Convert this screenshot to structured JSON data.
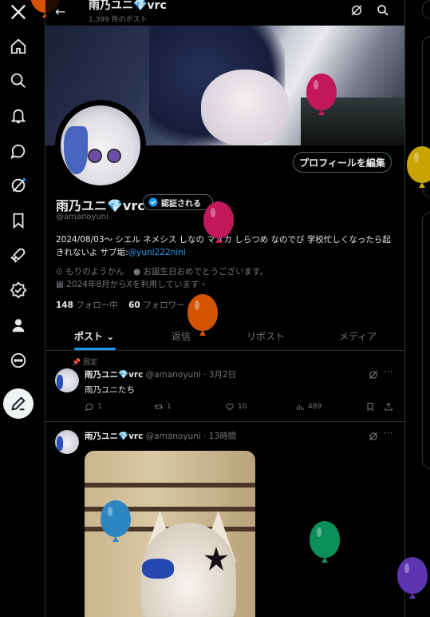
{
  "colors": {
    "accent": "#1d9bf0",
    "background": "#000000",
    "text": "#e7e9ea",
    "muted": "#71767b",
    "border": "#2f3336"
  },
  "topbar": {
    "name": "雨乃ユニ💎vrc",
    "post_count": "1,399 件のポスト"
  },
  "profile": {
    "name": "雨乃ユニ💎vrc",
    "verify_label": "認証される",
    "handle": "@amanoyuni",
    "edit_button": "プロフィールを編集",
    "bio_text": "2024/08/03～ シエル ネメシス しなの マヌカ しらつめ なのでび 学校忙しくなったら起きれないよ サブ垢:",
    "bio_link": "@yuni222nini",
    "location": "もりのようかん",
    "birthday": "お誕生日おめでとうございます。",
    "joined": "2024年8月からXを利用しています",
    "following_count": "148",
    "following_label": "フォロー中",
    "followers_count": "60",
    "followers_label": "フォロワー"
  },
  "tabs": [
    {
      "label": "ポスト"
    },
    {
      "label": "返信"
    },
    {
      "label": "リポスト"
    },
    {
      "label": "メディア"
    }
  ],
  "posts": [
    {
      "pinned_label": "固定",
      "name": "雨乃ユニ💎vrc",
      "handle_time": "@amanoyuni · 3月2日",
      "text": "雨乃ユニたち",
      "replies": "1",
      "reposts": "1",
      "likes": "10",
      "views": "489"
    },
    {
      "name": "雨乃ユニ💎vrc",
      "handle_time": "@amanoyuni · 13時間"
    }
  ],
  "icons": [
    "x-logo-icon",
    "home-icon",
    "search-icon",
    "bell-icon",
    "message-icon",
    "grok-icon",
    "bookmark-icon",
    "rocket-icon",
    "verified-icon",
    "profile-icon",
    "more-icon",
    "compose-icon",
    "back-arrow-icon",
    "search-icon",
    "more-horizontal-icon",
    "reply-icon",
    "repost-icon",
    "like-icon",
    "views-icon",
    "share-icon"
  ],
  "balloons": [
    {
      "color": "#c2185b"
    },
    {
      "color": "#c2185b"
    },
    {
      "color": "#d35400"
    },
    {
      "color": "#2e86c1"
    },
    {
      "color": "#0b8f5a"
    },
    {
      "color": "#5e35b1"
    },
    {
      "color": "#c9a400"
    },
    {
      "color": "#d35400"
    }
  ]
}
